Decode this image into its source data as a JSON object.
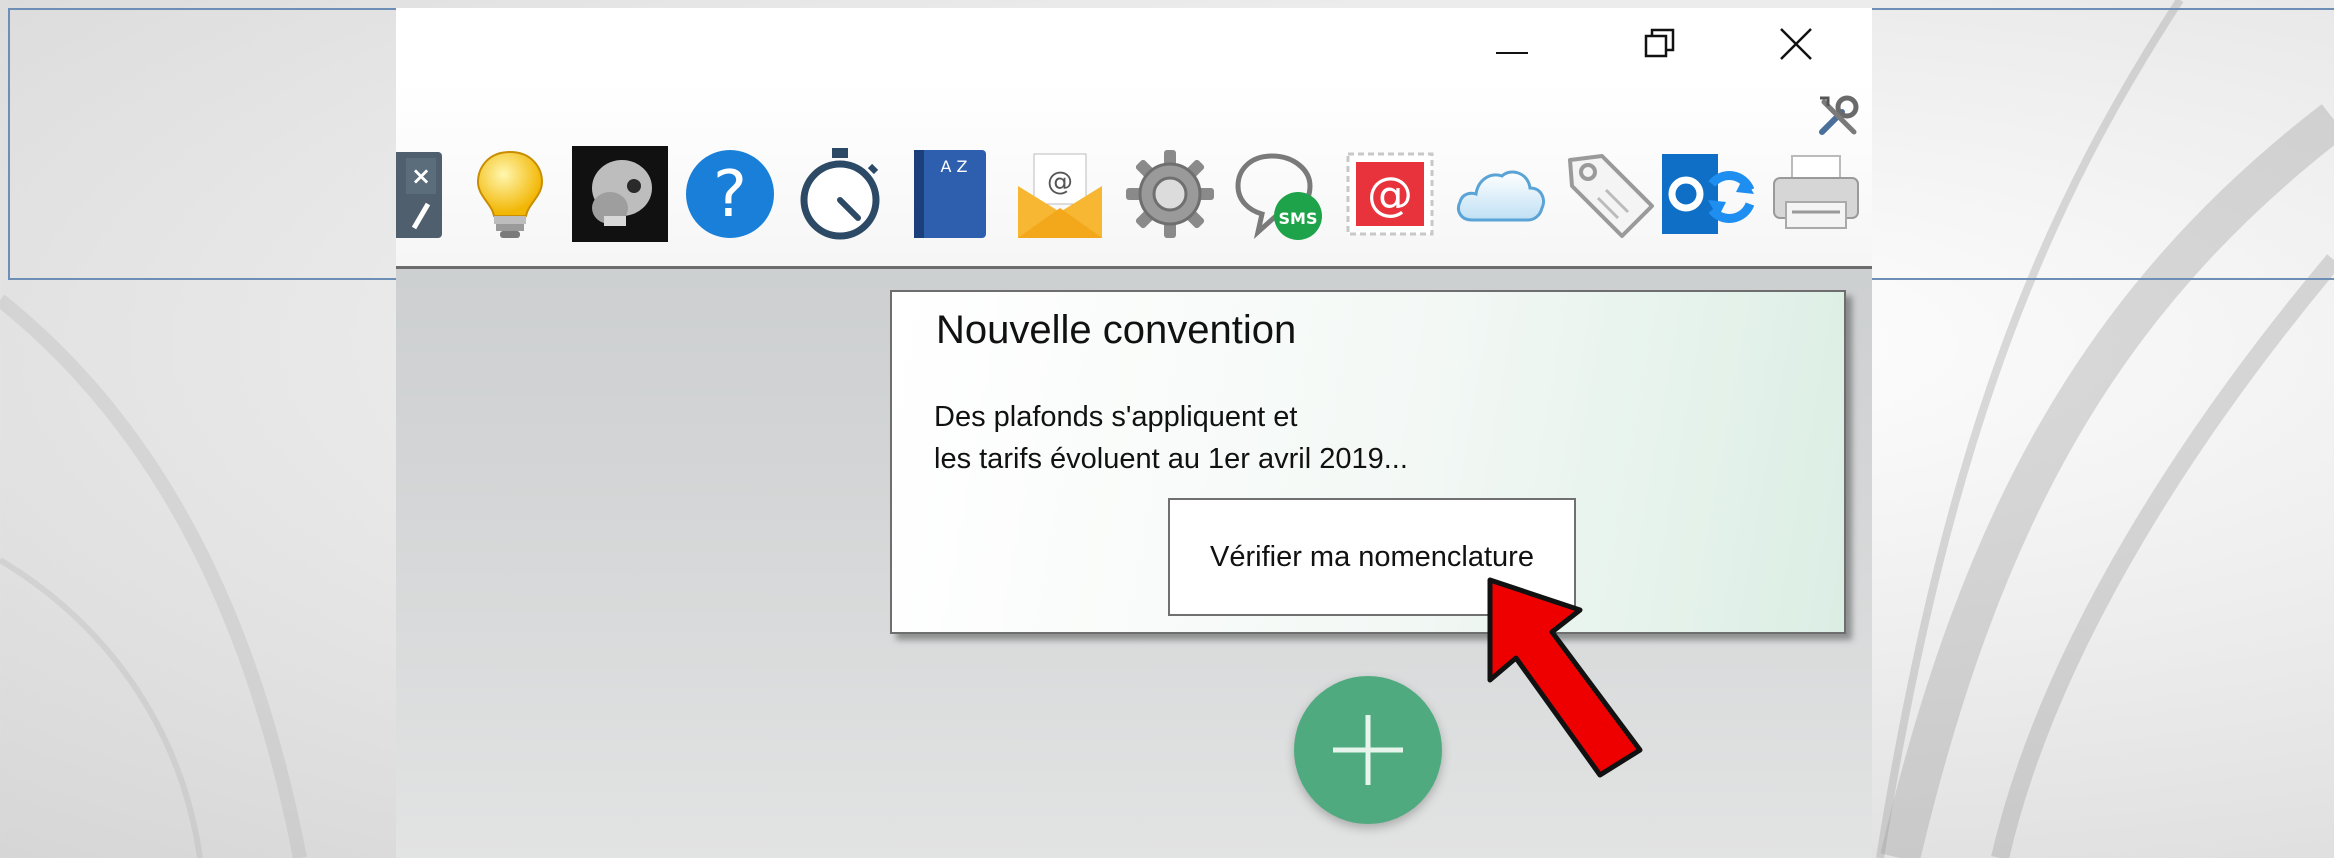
{
  "window": {
    "controls": {
      "minimize": "minimize-icon",
      "maximize": "restore-icon",
      "close": "close-icon"
    }
  },
  "toolbar": {
    "tools_icon": "tools-icon",
    "icons": [
      "calculator-icon",
      "lightbulb-icon",
      "xray-skull-icon",
      "help-icon",
      "stopwatch-icon",
      "address-book-icon",
      "email-envelope-icon",
      "settings-gear-icon",
      "sms-icon",
      "email-stamp-icon",
      "cloud-icon",
      "price-tag-icon",
      "outlook-sync-icon",
      "printer-icon"
    ],
    "icon_labels": {
      "address_book_letters": "A Z",
      "envelope_at": "@",
      "stamp_at": "@",
      "sms": "SMS"
    }
  },
  "notification": {
    "title": "Nouvelle convention",
    "body_line1": "Des plafonds s'appliquent et",
    "body_line2": "les tarifs évoluent au 1er avril 2019...",
    "button_label": "Vérifier ma nomenclature"
  },
  "fab": {
    "icon": "plus-icon"
  },
  "annotation": {
    "icon": "red-arrow-icon"
  },
  "colors": {
    "accent_green": "#4fab7f",
    "frame_line": "#6d8fb5",
    "arrow_red": "#ee0000",
    "help_blue": "#1a7fd8"
  }
}
